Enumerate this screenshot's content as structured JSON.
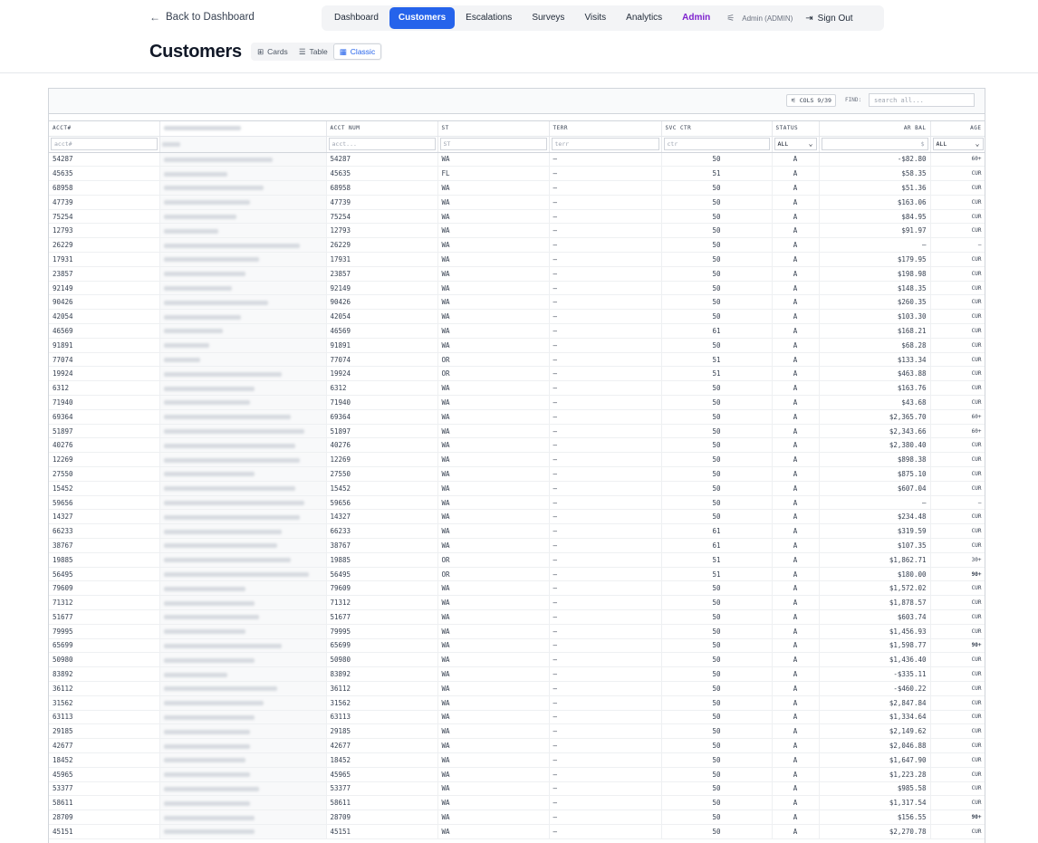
{
  "header": {
    "back_label": "Back to Dashboard",
    "page_title": "Customers"
  },
  "nav": {
    "items": [
      {
        "label": "Dashboard",
        "active": false
      },
      {
        "label": "Customers",
        "active": true
      },
      {
        "label": "Escalations",
        "active": false
      },
      {
        "label": "Surveys",
        "active": false
      },
      {
        "label": "Visits",
        "active": false
      },
      {
        "label": "Analytics",
        "active": false
      },
      {
        "label": "Admin",
        "active": false
      }
    ],
    "user_label": "Admin (ADMIN)",
    "sign_out_label": "Sign Out"
  },
  "view_toggle": {
    "options": [
      "Cards",
      "Table",
      "Classic"
    ],
    "selected": "Classic"
  },
  "toolbar": {
    "cols_label": "COLS 9/39",
    "find_label": "FIND:",
    "find_placeholder": "search all..."
  },
  "columns": [
    "ACCT#",
    "",
    "ACCT NUM",
    "ST",
    "TERR",
    "SVC CTR",
    "STATUS",
    "AR BAL",
    "AGE"
  ],
  "filters": {
    "acct_placeholder": "acct#",
    "acct_num_placeholder": "acct...",
    "st_placeholder": "ST",
    "terr_placeholder": "terr",
    "svc_placeholder": "ctr",
    "status_value": "ALL",
    "ar_placeholder": "$",
    "age_value": "ALL"
  },
  "colors": {
    "accent": "#2563eb",
    "admin": "#7e22ce",
    "link": "#1d4ed8",
    "negative_balance": "#15803d",
    "overdue_balance": "#b91c1c",
    "age_60": "#ea580c",
    "age_30": "#f59e0b",
    "age_90": "#dc2626"
  },
  "rows": [
    {
      "acct": "54287",
      "st": "WA",
      "terr": "—",
      "svc": "50",
      "status": "A",
      "bal": "-$82.80",
      "age": "60+",
      "tone": "neg"
    },
    {
      "acct": "45635",
      "st": "FL",
      "terr": "—",
      "svc": "51",
      "status": "A",
      "bal": "$58.35",
      "age": "CUR",
      "tone": ""
    },
    {
      "acct": "68958",
      "st": "WA",
      "terr": "—",
      "svc": "50",
      "status": "A",
      "bal": "$51.36",
      "age": "CUR",
      "tone": ""
    },
    {
      "acct": "47739",
      "st": "WA",
      "terr": "—",
      "svc": "50",
      "status": "A",
      "bal": "$163.06",
      "age": "CUR",
      "tone": ""
    },
    {
      "acct": "75254",
      "st": "WA",
      "terr": "—",
      "svc": "50",
      "status": "A",
      "bal": "$84.95",
      "age": "CUR",
      "tone": ""
    },
    {
      "acct": "12793",
      "st": "WA",
      "terr": "—",
      "svc": "50",
      "status": "A",
      "bal": "$91.97",
      "age": "CUR",
      "tone": ""
    },
    {
      "acct": "26229",
      "st": "WA",
      "terr": "—",
      "svc": "50",
      "status": "A",
      "bal": "—",
      "age": "—",
      "tone": "none"
    },
    {
      "acct": "17931",
      "st": "WA",
      "terr": "—",
      "svc": "50",
      "status": "A",
      "bal": "$179.95",
      "age": "CUR",
      "tone": ""
    },
    {
      "acct": "23857",
      "st": "WA",
      "terr": "—",
      "svc": "50",
      "status": "A",
      "bal": "$198.98",
      "age": "CUR",
      "tone": ""
    },
    {
      "acct": "92149",
      "st": "WA",
      "terr": "—",
      "svc": "50",
      "status": "A",
      "bal": "$148.35",
      "age": "CUR",
      "tone": ""
    },
    {
      "acct": "90426",
      "st": "WA",
      "terr": "—",
      "svc": "50",
      "status": "A",
      "bal": "$260.35",
      "age": "CUR",
      "tone": ""
    },
    {
      "acct": "42054",
      "st": "WA",
      "terr": "—",
      "svc": "50",
      "status": "A",
      "bal": "$103.30",
      "age": "CUR",
      "tone": ""
    },
    {
      "acct": "46569",
      "st": "WA",
      "terr": "—",
      "svc": "61",
      "status": "A",
      "bal": "$168.21",
      "age": "CUR",
      "tone": ""
    },
    {
      "acct": "91891",
      "st": "WA",
      "terr": "—",
      "svc": "50",
      "status": "A",
      "bal": "$68.28",
      "age": "CUR",
      "tone": ""
    },
    {
      "acct": "77074",
      "st": "OR",
      "terr": "—",
      "svc": "51",
      "status": "A",
      "bal": "$133.34",
      "age": "CUR",
      "tone": ""
    },
    {
      "acct": "19924",
      "st": "OR",
      "terr": "—",
      "svc": "51",
      "status": "A",
      "bal": "$463.88",
      "age": "CUR",
      "tone": ""
    },
    {
      "acct": "6312",
      "st": "WA",
      "terr": "—",
      "svc": "50",
      "status": "A",
      "bal": "$163.76",
      "age": "CUR",
      "tone": ""
    },
    {
      "acct": "71940",
      "st": "WA",
      "terr": "—",
      "svc": "50",
      "status": "A",
      "bal": "$43.68",
      "age": "CUR",
      "tone": ""
    },
    {
      "acct": "69364",
      "st": "WA",
      "terr": "—",
      "svc": "50",
      "status": "A",
      "bal": "$2,365.70",
      "age": "60+",
      "tone": ""
    },
    {
      "acct": "51897",
      "st": "WA",
      "terr": "—",
      "svc": "50",
      "status": "A",
      "bal": "$2,343.66",
      "age": "60+",
      "tone": ""
    },
    {
      "acct": "40276",
      "st": "WA",
      "terr": "—",
      "svc": "50",
      "status": "A",
      "bal": "$2,380.40",
      "age": "CUR",
      "tone": ""
    },
    {
      "acct": "12269",
      "st": "WA",
      "terr": "—",
      "svc": "50",
      "status": "A",
      "bal": "$898.38",
      "age": "CUR",
      "tone": ""
    },
    {
      "acct": "27550",
      "st": "WA",
      "terr": "—",
      "svc": "50",
      "status": "A",
      "bal": "$875.10",
      "age": "CUR",
      "tone": ""
    },
    {
      "acct": "15452",
      "st": "WA",
      "terr": "—",
      "svc": "50",
      "status": "A",
      "bal": "$607.04",
      "age": "CUR",
      "tone": ""
    },
    {
      "acct": "59656",
      "st": "WA",
      "terr": "—",
      "svc": "50",
      "status": "A",
      "bal": "—",
      "age": "—",
      "tone": "none"
    },
    {
      "acct": "14327",
      "st": "WA",
      "terr": "—",
      "svc": "50",
      "status": "A",
      "bal": "$234.48",
      "age": "CUR",
      "tone": ""
    },
    {
      "acct": "66233",
      "st": "WA",
      "terr": "—",
      "svc": "61",
      "status": "A",
      "bal": "$319.59",
      "age": "CUR",
      "tone": ""
    },
    {
      "acct": "38767",
      "st": "WA",
      "terr": "—",
      "svc": "61",
      "status": "A",
      "bal": "$107.35",
      "age": "CUR",
      "tone": ""
    },
    {
      "acct": "19885",
      "st": "OR",
      "terr": "—",
      "svc": "51",
      "status": "A",
      "bal": "$1,862.71",
      "age": "30+",
      "tone": ""
    },
    {
      "acct": "56495",
      "st": "OR",
      "terr": "—",
      "svc": "51",
      "status": "A",
      "bal": "$180.00",
      "age": "90+",
      "tone": "over"
    },
    {
      "acct": "79609",
      "st": "WA",
      "terr": "—",
      "svc": "50",
      "status": "A",
      "bal": "$1,572.02",
      "age": "CUR",
      "tone": ""
    },
    {
      "acct": "71312",
      "st": "WA",
      "terr": "—",
      "svc": "50",
      "status": "A",
      "bal": "$1,878.57",
      "age": "CUR",
      "tone": ""
    },
    {
      "acct": "51677",
      "st": "WA",
      "terr": "—",
      "svc": "50",
      "status": "A",
      "bal": "$603.74",
      "age": "CUR",
      "tone": ""
    },
    {
      "acct": "79995",
      "st": "WA",
      "terr": "—",
      "svc": "50",
      "status": "A",
      "bal": "$1,456.93",
      "age": "CUR",
      "tone": ""
    },
    {
      "acct": "65699",
      "st": "WA",
      "terr": "—",
      "svc": "50",
      "status": "A",
      "bal": "$1,598.77",
      "age": "90+",
      "tone": "over"
    },
    {
      "acct": "50980",
      "st": "WA",
      "terr": "—",
      "svc": "50",
      "status": "A",
      "bal": "$1,436.40",
      "age": "CUR",
      "tone": ""
    },
    {
      "acct": "83892",
      "st": "WA",
      "terr": "—",
      "svc": "50",
      "status": "A",
      "bal": "-$335.11",
      "age": "CUR",
      "tone": "neg"
    },
    {
      "acct": "36112",
      "st": "WA",
      "terr": "—",
      "svc": "50",
      "status": "A",
      "bal": "-$460.22",
      "age": "CUR",
      "tone": "neg"
    },
    {
      "acct": "31562",
      "st": "WA",
      "terr": "—",
      "svc": "50",
      "status": "A",
      "bal": "$2,847.84",
      "age": "CUR",
      "tone": ""
    },
    {
      "acct": "63113",
      "st": "WA",
      "terr": "—",
      "svc": "50",
      "status": "A",
      "bal": "$1,334.64",
      "age": "CUR",
      "tone": ""
    },
    {
      "acct": "29185",
      "st": "WA",
      "terr": "—",
      "svc": "50",
      "status": "A",
      "bal": "$2,149.62",
      "age": "CUR",
      "tone": ""
    },
    {
      "acct": "42677",
      "st": "WA",
      "terr": "—",
      "svc": "50",
      "status": "A",
      "bal": "$2,046.88",
      "age": "CUR",
      "tone": ""
    },
    {
      "acct": "18452",
      "st": "WA",
      "terr": "—",
      "svc": "50",
      "status": "A",
      "bal": "$1,647.90",
      "age": "CUR",
      "tone": ""
    },
    {
      "acct": "45965",
      "st": "WA",
      "terr": "—",
      "svc": "50",
      "status": "A",
      "bal": "$1,223.28",
      "age": "CUR",
      "tone": ""
    },
    {
      "acct": "53377",
      "st": "WA",
      "terr": "—",
      "svc": "50",
      "status": "A",
      "bal": "$985.58",
      "age": "CUR",
      "tone": ""
    },
    {
      "acct": "58611",
      "st": "WA",
      "terr": "—",
      "svc": "50",
      "status": "A",
      "bal": "$1,317.54",
      "age": "CUR",
      "tone": ""
    },
    {
      "acct": "28709",
      "st": "WA",
      "terr": "—",
      "svc": "50",
      "status": "A",
      "bal": "$156.55",
      "age": "90+",
      "tone": "over"
    },
    {
      "acct": "45151",
      "st": "WA",
      "terr": "—",
      "svc": "50",
      "status": "A",
      "bal": "$2,270.78",
      "age": "CUR",
      "tone": ""
    }
  ]
}
